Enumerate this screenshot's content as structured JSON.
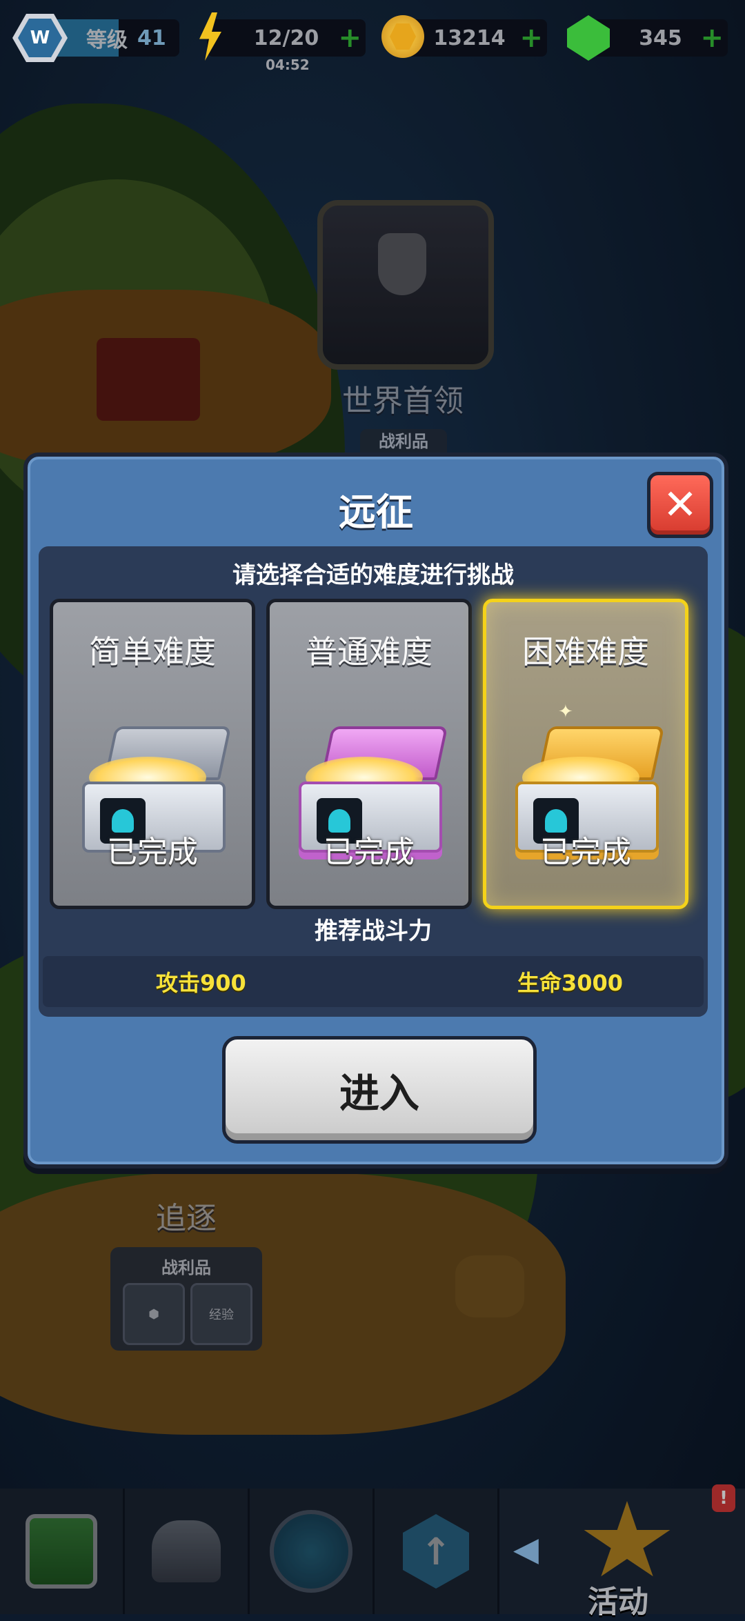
{
  "hud": {
    "level_label": "等级",
    "level_value": "41",
    "level_progress": 0.58,
    "energy": "12/20",
    "energy_timer": "04:52",
    "coins": "13214",
    "gems": "345"
  },
  "map": {
    "world_boss_label": "世界首领",
    "loot_label_top": "战利品",
    "chase_label": "追逐",
    "loot_label": "战利品",
    "loot_exp_label": "经验"
  },
  "dialog": {
    "title": "远征",
    "subtitle": "请选择合适的难度进行挑战",
    "difficulties": [
      {
        "label": "简单难度",
        "status": "已完成",
        "chest_color": "silver"
      },
      {
        "label": "普通难度",
        "status": "已完成",
        "chest_color": "#d27ad8"
      },
      {
        "label": "困难难度",
        "status": "已完成",
        "chest_color": "#f4b53a"
      }
    ],
    "selected_difficulty": 2,
    "recommend_title": "推荐战斗力",
    "attack": "攻击900",
    "health": "生命3000",
    "enter_label": "进入"
  },
  "bottom_nav": {
    "event_label": "活动",
    "event_badge": "!"
  },
  "colors": {
    "dialog_bg": "#4c7aaf",
    "panel_bg": "#2b3b57",
    "selected_border": "#f4d21a",
    "stat_text": "#f7e23a",
    "close_red": "#e0463a"
  }
}
